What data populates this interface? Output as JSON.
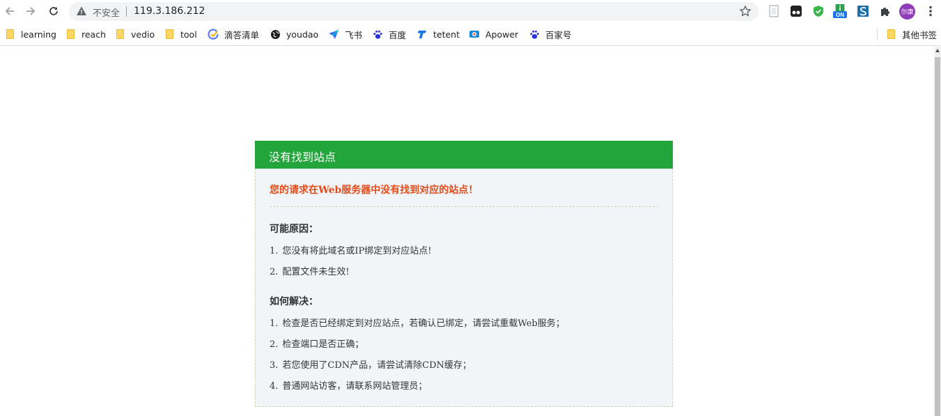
{
  "browser": {
    "insecure_label": "不安全",
    "url": "119.3.186.212",
    "profile_initials": "尔康",
    "ext_badge": "ON"
  },
  "bookmarks": [
    {
      "label": "learning",
      "icon": "folder-icon"
    },
    {
      "label": "reach",
      "icon": "folder-icon"
    },
    {
      "label": "vedio",
      "icon": "folder-icon"
    },
    {
      "label": "tool",
      "icon": "folder-icon"
    },
    {
      "label": "滴答清单",
      "icon": "check-circle-icon"
    },
    {
      "label": "youdao",
      "icon": "globe-icon"
    },
    {
      "label": "飞书",
      "icon": "paper-plane-icon"
    },
    {
      "label": "百度",
      "icon": "paw-icon"
    },
    {
      "label": "tetent",
      "icon": "tetent-logo-icon"
    },
    {
      "label": "Apower",
      "icon": "camera-icon"
    },
    {
      "label": "百家号",
      "icon": "paw-icon"
    }
  ],
  "other_bookmarks": {
    "label": "其他书签",
    "icon": "folder-icon"
  },
  "page": {
    "header": "没有找到站点",
    "error_message": "您的请求在Web服务器中没有找到对应的站点！",
    "reasons_title": "可能原因：",
    "reasons": [
      {
        "num": "1.",
        "text": "您没有将此域名或IP绑定到对应站点!"
      },
      {
        "num": "2.",
        "text": "配置文件未生效!"
      }
    ],
    "solutions_title": "如何解决：",
    "solutions": [
      {
        "num": "1.",
        "text": "检查是否已经绑定到对应站点，若确认已绑定，请尝试重载Web服务；"
      },
      {
        "num": "2.",
        "text": "检查端口是否正确；"
      },
      {
        "num": "3.",
        "text": "若您使用了CDN产品，请尝试清除CDN缓存；"
      },
      {
        "num": "4.",
        "text": "普通网站访客，请联系网站管理员；"
      }
    ]
  },
  "colors": {
    "header_green": "#22a63c",
    "error_red": "#e64a19",
    "card_bg": "#f2f5f7"
  }
}
